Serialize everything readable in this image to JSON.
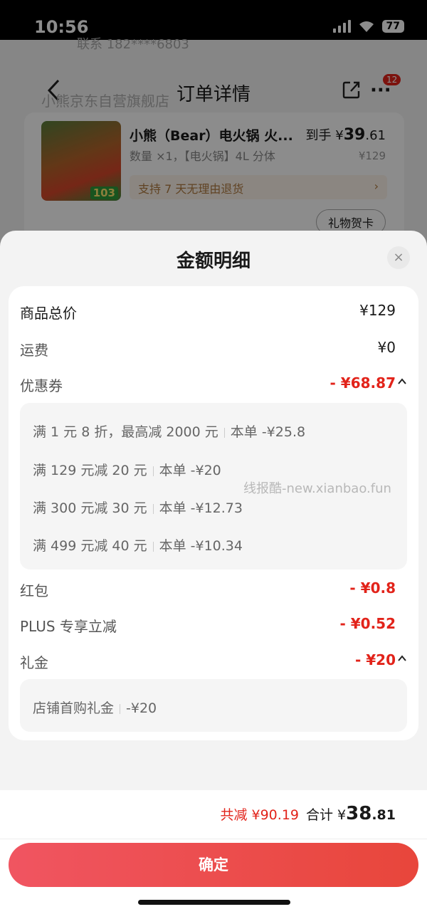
{
  "status_bar": {
    "time": "10:56",
    "battery": "77"
  },
  "background": {
    "phone": "联系 182****6803",
    "title": "订单详情",
    "badge_count": "12",
    "shop_name": "小熊京东自营旗舰店",
    "product": {
      "name": "小熊（Bear）电火锅 火...",
      "spec": "数量 ×1，【电火锅】4L 分体",
      "price_prefix": "到手 ¥",
      "price_int": "39",
      "price_dec": ".61",
      "orig_price": "¥129",
      "image_tag": "103",
      "return_policy": "支持 7 天无理由退货",
      "gift_card": "礼物贺卡"
    }
  },
  "sheet": {
    "title": "金额明细",
    "close": "×",
    "rows": {
      "total": {
        "label": "商品总价",
        "value": "¥129"
      },
      "shipping": {
        "label": "运费",
        "value": "¥0"
      },
      "coupon": {
        "label": "优惠券",
        "value": "- ¥68.87"
      },
      "redpacket": {
        "label": "红包",
        "value": "- ¥0.8"
      },
      "plus": {
        "label": "PLUS 专享立减",
        "value": "- ¥0.52"
      },
      "gift": {
        "label": "礼金",
        "value": "- ¥20"
      }
    },
    "coupon_items": [
      {
        "rule": "满 1 元 8 折，最高减 2000 元",
        "amount": "本单 -¥25.8"
      },
      {
        "rule": "满 129 元减 20 元",
        "amount": "本单 -¥20"
      },
      {
        "rule": "满 300 元减 30 元",
        "amount": "本单 -¥12.73"
      },
      {
        "rule": "满 499 元减 40 元",
        "amount": "本单 -¥10.34"
      }
    ],
    "gift_items": [
      {
        "rule": "店铺首购礼金",
        "amount": "-¥20"
      }
    ],
    "watermark": "线报酷-new.xianbao.fun",
    "footer": {
      "saved": "共减 ¥90.19",
      "sum_label": "合计 ¥",
      "sum_int": "38",
      "sum_dec": ".81",
      "confirm": "确定"
    }
  },
  "colors": {
    "accent": "#e2231a",
    "button_start": "#f05561",
    "button_end": "#e8463b"
  }
}
